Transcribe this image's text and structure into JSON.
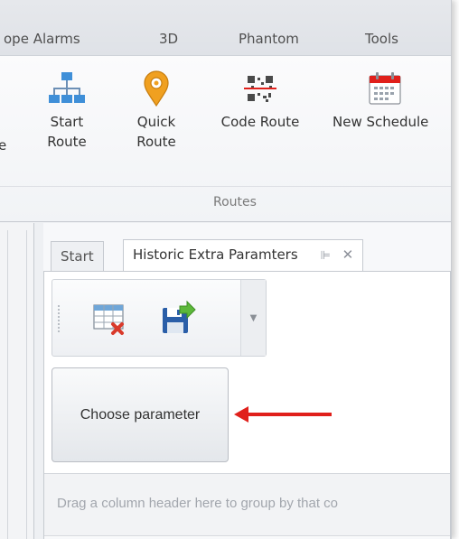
{
  "ribbon": {
    "tabs": [
      "ope Alarms",
      "3D",
      "Phantom",
      "Tools"
    ],
    "partial_button_label": "e",
    "buttons": [
      {
        "line1": "Start",
        "line2": "Route",
        "icon": "hierarchy-icon"
      },
      {
        "line1": "Quick",
        "line2": "Route",
        "icon": "map-pin-icon"
      },
      {
        "line1": "Code Route",
        "line2": "",
        "icon": "qr-code-icon"
      },
      {
        "line1": "New Schedule",
        "line2": "",
        "icon": "calendar-icon"
      }
    ],
    "group_label": "Routes"
  },
  "document": {
    "tabs": [
      {
        "label": "Start",
        "active": false
      },
      {
        "label": "Historic Extra Paramters",
        "active": true,
        "pin": "⊫",
        "close": "✕"
      }
    ],
    "toolbar": {
      "buttons": [
        {
          "name": "delete-table-button",
          "icon": "table-delete-icon"
        },
        {
          "name": "save-export-button",
          "icon": "save-arrow-icon"
        }
      ],
      "overflow_glyph": "▼"
    },
    "choose_button_label": "Choose parameter",
    "group_panel_hint": "Drag a column header here to group by that co"
  },
  "colors": {
    "accent_red": "#e0201b",
    "pin_orange": "#f0a020",
    "floppy_blue": "#2a5ea8",
    "export_green": "#5cb83a"
  }
}
